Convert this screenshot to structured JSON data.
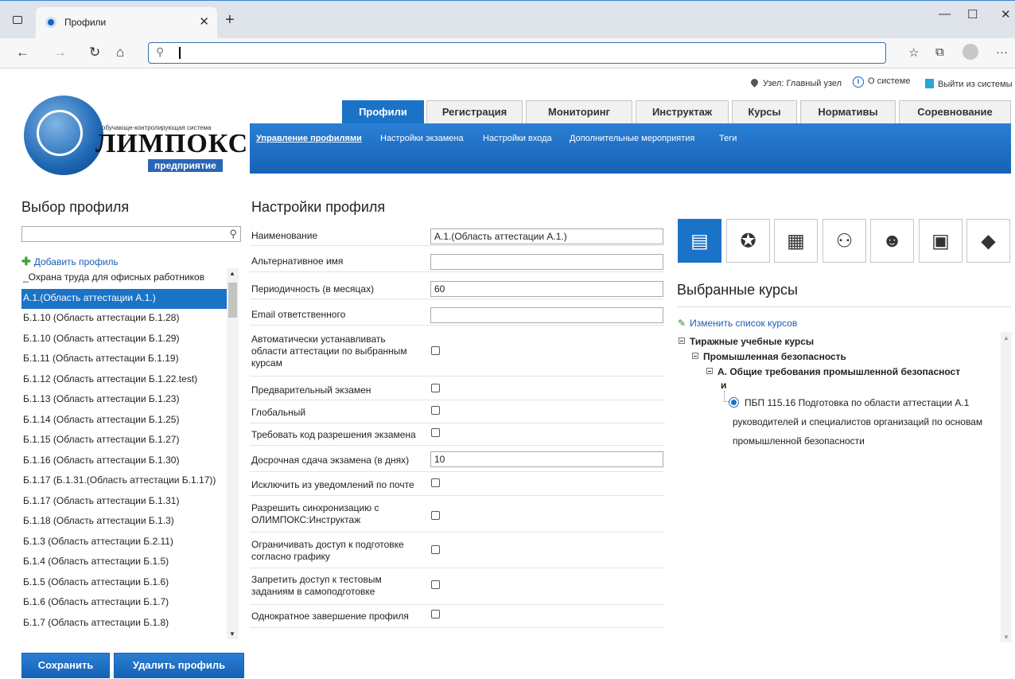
{
  "browser": {
    "tab_title": "Профили",
    "address": ""
  },
  "header": {
    "node_label": "Узел: Главный узел",
    "about_label": "О системе",
    "logout_label": "Выйти из системы"
  },
  "logo": {
    "subtitle": "обучающе-контролирующая система",
    "name": "ЛИМПОКС",
    "edition": "предприятие"
  },
  "main_tabs": [
    {
      "label": "Профили",
      "active": true
    },
    {
      "label": "Регистрация"
    },
    {
      "label": "Мониторинг"
    },
    {
      "label": "Инструктаж"
    },
    {
      "label": "Курсы"
    },
    {
      "label": "Нормативы"
    },
    {
      "label": "Соревнование"
    }
  ],
  "sub_tabs": [
    {
      "label": "Управление профилями",
      "active": true
    },
    {
      "label": "Настройки экзамена"
    },
    {
      "label": "Настройки входа"
    },
    {
      "label": "Дополнительные мероприятия"
    },
    {
      "label": "Теги"
    }
  ],
  "profile_select": {
    "title": "Выбор профиля",
    "search_value": "",
    "add_label": "Добавить профиль",
    "items": [
      "_Охрана труда для офисных работников",
      "А.1.(Область аттестации А.1.)",
      "Б.1.10 (Область аттестации Б.1.28)",
      "Б.1.10 (Область аттестации Б.1.29)",
      "Б.1.11 (Область аттестации Б.1.19)",
      "Б.1.12 (Область аттестации Б.1.22.test)",
      "Б.1.13 (Область аттестации Б.1.23)",
      "Б.1.14 (Область аттестации Б.1.25)",
      "Б.1.15 (Область аттестации Б.1.27)",
      "Б.1.16 (Область аттестации Б.1.30)",
      "Б.1.17 (Б.1.31.(Область аттестации Б.1.17))",
      "Б.1.17 (Область аттестации Б.1.31)",
      "Б.1.18 (Область аттестации Б.1.3)",
      "Б.1.3 (Область аттестации Б.2.11)",
      "Б.1.4 (Область аттестации Б.1.5)",
      "Б.1.5 (Область аттестации Б.1.6)",
      "Б.1.6 (Область аттестации Б.1.7)",
      "Б.1.7 (Область аттестации Б.1.8)"
    ],
    "selected_index": 1
  },
  "settings": {
    "title": "Настройки профиля",
    "name_label": "Наименование",
    "name_value": "А.1.(Область аттестации А.1.)",
    "alt_label": "Альтернативное имя",
    "alt_value": "",
    "period_label": "Периодичность (в месяцах)",
    "period_value": "60",
    "email_label": "Email ответственного",
    "email_value": "",
    "auto_label": "Автоматически устанавливать области аттестации по выбранным курсам",
    "prelim_label": "Предварительный экзамен",
    "global_label": "Глобальный",
    "code_label": "Требовать код разрешения экзамена",
    "early_label": "Досрочная сдача экзамена (в днях)",
    "early_value": "10",
    "exclude_label": "Исключить из уведомлений по почте",
    "sync_label": "Разрешить синхронизацию с ОЛИМПОКС:Инструктаж",
    "restrict_label": "Ограничивать доступ к подготовке согласно графику",
    "deny_label": "Запретить доступ к тестовым заданиям в самоподготовке",
    "once_label": "Однократное завершение профиля"
  },
  "courses": {
    "title": "Выбранные курсы",
    "edit_label": "Изменить список курсов",
    "tree_level1": "Тиражные учебные курсы",
    "tree_level2": "Промышленная безопасность",
    "tree_level3_line1": "А. Общие требования промышленной безопасност",
    "tree_level3_line2": "и",
    "course_line1": "ПБП 115.16 Подготовка по области аттестации А.1",
    "course_line2": "руководителей и специалистов организаций по основам",
    "course_line3": "промышленной безопасности"
  },
  "actions": {
    "save_label": "Сохранить",
    "delete_label": "Удалить профиль"
  },
  "icons": [
    "courses-icon",
    "certificate-icon",
    "building-icon",
    "hierarchy-icon",
    "workers-icon",
    "calendar-icon",
    "tag-icon"
  ],
  "colors": {
    "accent": "#1a73c7",
    "link": "#1a5fb4"
  }
}
